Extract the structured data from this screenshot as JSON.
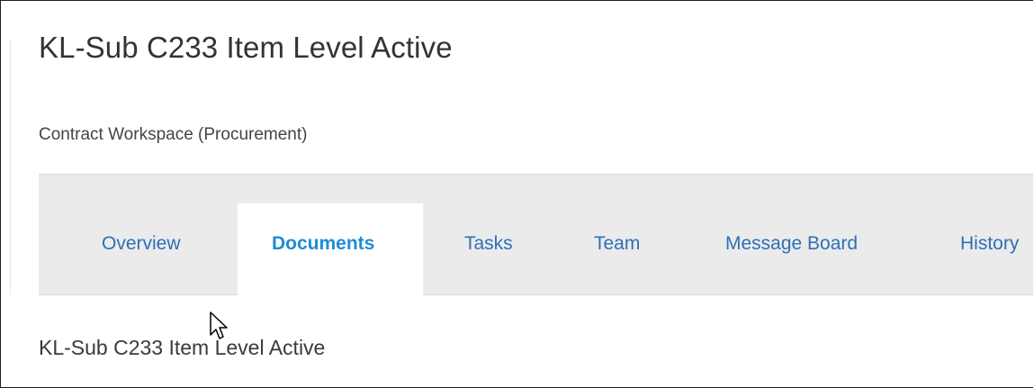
{
  "header": {
    "title": "KL-Sub C233 Item Level Active",
    "subtitle": "Contract Workspace (Procurement)"
  },
  "tabs": [
    {
      "label": "Overview",
      "active": false
    },
    {
      "label": "Documents",
      "active": true
    },
    {
      "label": "Tasks",
      "active": false
    },
    {
      "label": "Team",
      "active": false
    },
    {
      "label": "Message Board",
      "active": false
    },
    {
      "label": "History",
      "active": false
    }
  ],
  "content": {
    "heading": "KL-Sub C233 Item Level Active"
  },
  "colors": {
    "tab_link": "#2f6fb6",
    "tab_active": "#1f8bd6",
    "tab_bar_bg": "#ebebeb"
  },
  "icons": {
    "cursor": "arrow-pointer-icon"
  }
}
